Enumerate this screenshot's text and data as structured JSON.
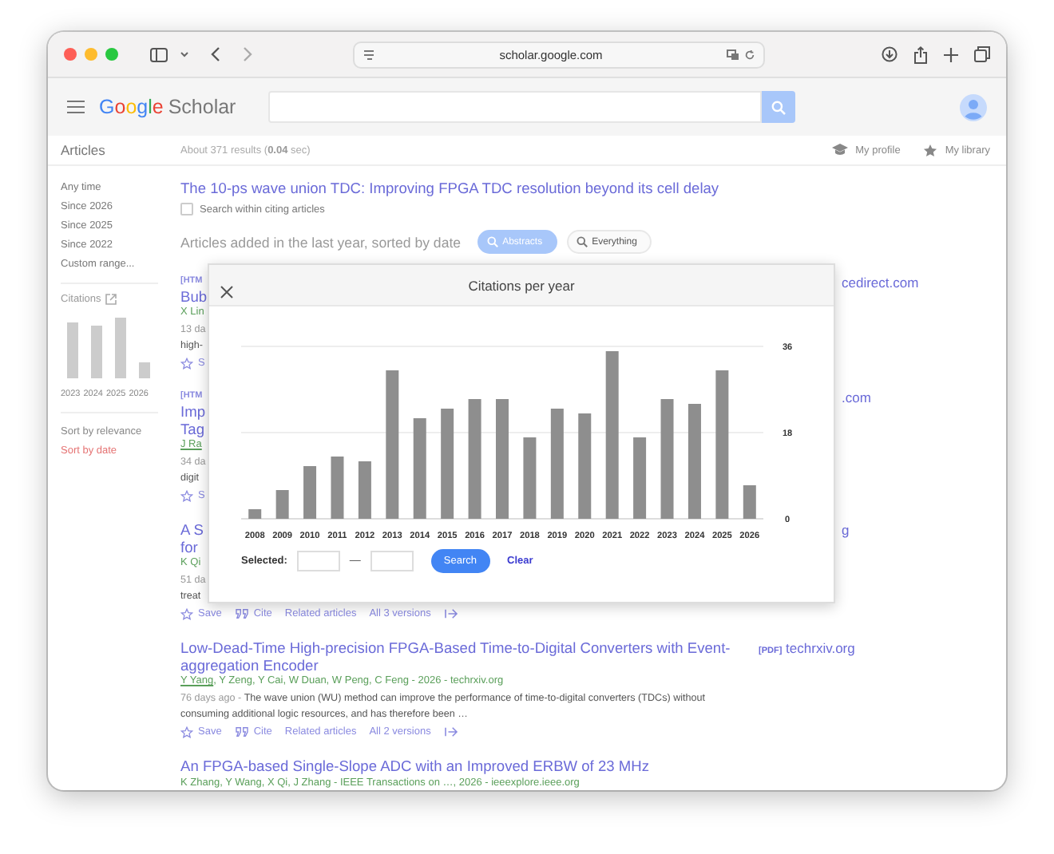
{
  "browser": {
    "address": "scholar.google.com"
  },
  "header": {
    "logo_brand": "Google",
    "logo_product": "Scholar"
  },
  "toolbar": {
    "section": "Articles",
    "results_info": "About 371 results (**0.04** sec)",
    "links": [
      "My profile",
      "My library"
    ]
  },
  "sidebar": {
    "time_filters": [
      "Any time",
      "Since 2026",
      "Since 2025",
      "Since 2022",
      "Custom range..."
    ],
    "citations_label": "Citations",
    "citation_years": [
      "2023",
      "2024",
      "2025",
      "2026"
    ],
    "sort": [
      {
        "label": "Sort by relevance",
        "selected": false
      },
      {
        "label": "Sort by date",
        "selected": true
      }
    ]
  },
  "cited_article": {
    "title": "The 10-ps wave union TDC: Improving FPGA TDC resolution beyond its cell delay",
    "citing_search": {
      "label": "Search within citing articles",
      "checked": false
    }
  },
  "alert": {
    "text": "Articles added in the last year, sorted by date",
    "chips": [
      {
        "label": "Abstracts",
        "selected": true
      },
      {
        "label": "Everything",
        "selected": false
      }
    ]
  },
  "results": [
    {
      "kind": "covered",
      "tag": "[HTM",
      "title_lines": [
        "Bub"
      ],
      "authors": "X Lin",
      "age": "13 da",
      "snippet_lines": [
        "high-"
      ],
      "actions": [
        "S"
      ],
      "source": "cedirect.com"
    },
    {
      "kind": "covered",
      "tag": "[HTM",
      "title_lines": [
        "Imp",
        "Tag"
      ],
      "author_link": "J Ra",
      "age": "34 da",
      "snippet_lines": [
        "digit"
      ],
      "actions": [
        "S"
      ],
      "source": ".com"
    },
    {
      "kind": "covered",
      "title_lines": [
        "A S",
        "for"
      ],
      "authors": "K Qi",
      "age": "51 da",
      "snippet_lines": [
        "treat"
      ],
      "actions": [
        "Save",
        "Cite",
        "Related articles",
        "All 3 versions"
      ],
      "source": "g"
    },
    {
      "kind": "full",
      "title": "Low-Dead-Time High-precision FPGA-Based Time-to-Digital Converters with Event-aggregation Encoder",
      "source_type": "[PDF]",
      "source": "techrxiv.org",
      "author_link": "Y Yang",
      "authors": ", Y Zeng, Y Cai, W Duan, W Peng, C Feng - 2026 - techrxiv.org",
      "age": "76 days ago -",
      "snippet": "The wave union (WU) method can improve the performance of time-to-digital converters (TDCs) without consuming additional logic resources, and has therefore been …",
      "actions": [
        "Save",
        "Cite",
        "Related articles",
        "All 2 versions"
      ]
    },
    {
      "kind": "full",
      "title": "An FPGA-based Single-Slope ADC with an Improved ERBW of 23 MHz",
      "authors": "K Zhang, Y Wang, X Qi, J Zhang - IEEE Transactions on …, 2026 - ieeexplore.ieee.org"
    }
  ],
  "dialog": {
    "title": "Citations per year",
    "chart_data": {
      "type": "bar",
      "categories": [
        "2008",
        "2009",
        "2010",
        "2011",
        "2012",
        "2013",
        "2014",
        "2015",
        "2016",
        "2017",
        "2018",
        "2019",
        "2020",
        "2021",
        "2022",
        "2023",
        "2024",
        "2025",
        "2026"
      ],
      "values": [
        2,
        6,
        11,
        13,
        12,
        31,
        21,
        23,
        25,
        25,
        17,
        23,
        22,
        35,
        17,
        25,
        24,
        31,
        7
      ],
      "ylim": [
        0,
        36
      ],
      "yticks": [
        0,
        18,
        36
      ]
    },
    "selected_label": "Selected:",
    "range_dash": "—",
    "search_button": "Search",
    "clear_link": "Clear"
  }
}
